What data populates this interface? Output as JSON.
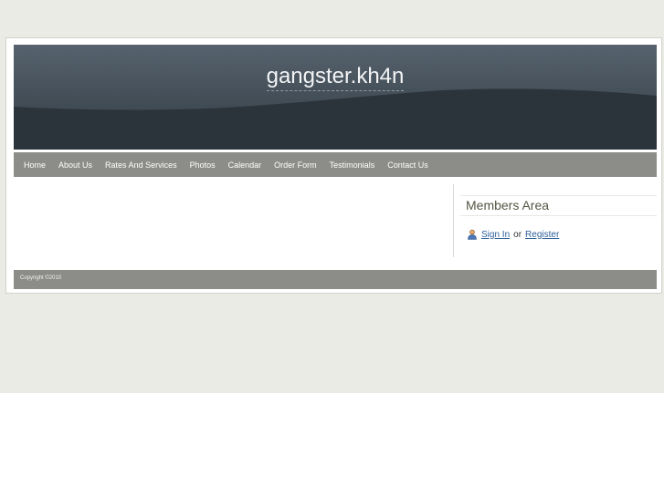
{
  "site": {
    "title": "gangster.kh4n"
  },
  "nav": {
    "items": [
      {
        "label": "Home"
      },
      {
        "label": "About Us"
      },
      {
        "label": "Rates And Services"
      },
      {
        "label": "Photos"
      },
      {
        "label": "Calendar"
      },
      {
        "label": "Order Form"
      },
      {
        "label": "Testimonials"
      },
      {
        "label": "Contact Us"
      }
    ]
  },
  "sidebar": {
    "members_title": "Members Area",
    "sign_in": "Sign In",
    "or_text": "or",
    "register": "Register",
    "icon": "user-icon"
  },
  "footer": {
    "copyright": "Copyright ©2010"
  },
  "colors": {
    "page_band": "#ebebe6",
    "header_top": "#5b6873",
    "header_bottom": "#2c343b",
    "nav_bar": "#8c8c88",
    "link": "#2a5d9a"
  }
}
